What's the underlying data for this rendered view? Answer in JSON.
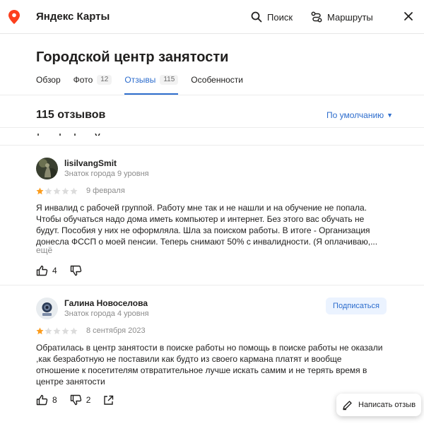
{
  "topbar": {
    "brand": "Яндекс Карты",
    "search_label": "Поиск",
    "routes_label": "Маршруты"
  },
  "org": {
    "title": "Городской центр занятости"
  },
  "tabs": [
    {
      "label": "Обзор",
      "count": ""
    },
    {
      "label": "Фото",
      "count": "12"
    },
    {
      "label": "Отзывы",
      "count": "115"
    },
    {
      "label": "Особенности",
      "count": ""
    }
  ],
  "reviews_header": {
    "count_label": "115 отзывов",
    "sort_label": "По умолчанию"
  },
  "reviews": [
    {
      "author": "lisilvangSmit",
      "rank": "Знаток города 9 уровня",
      "rating": 1,
      "date": "9 февраля",
      "text": "Я инвалид с рабочей группой. Работу мне так и не нашли и на обучение не попала. Чтобы обучаться надо дома иметь компьютер и интернет. Без этого вас обучать не будут. Пособия у них не оформляла. Шла за поиском работы. В итоге - Организация донесла ФССП о моей пенсии. Теперь снимают 50% с инвалидности. (Я оплачиваю,...",
      "more": "ещё",
      "likes": "4",
      "dislikes": ""
    },
    {
      "author": "Галина Новоселова",
      "rank": "Знаток города 4 уровня",
      "rating": 1,
      "date": "8 сентября 2023",
      "text": "Обратилась в центр занятости в поиске работы но помощь в поиске работы не оказали ,как безработную не поставили как будто из своего кармана платят и вообще отношение к посетителям отвратительное лучше искать самим и не терять время в центре занятости",
      "subscribe": "Подписаться",
      "likes": "8",
      "dislikes": "2"
    }
  ],
  "write_review_label": "Написать отзыв",
  "colors": {
    "accent": "#2d6dcd",
    "star_filled": "#fc3f1d",
    "star_empty": "#d9d9d9",
    "logo_red": "#fc3f1d"
  }
}
